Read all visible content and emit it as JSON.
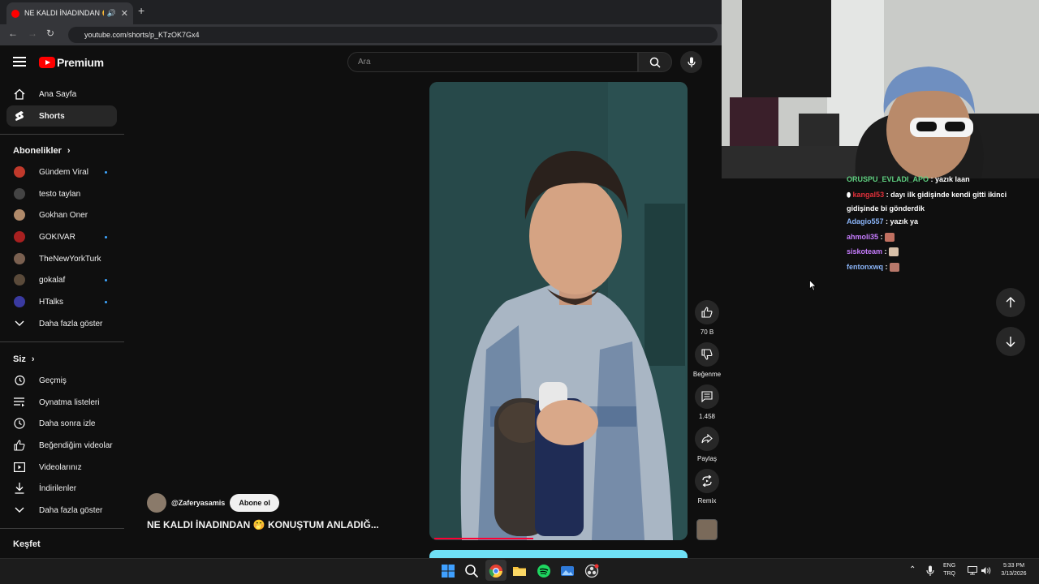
{
  "browser": {
    "tab_title": "NE KALDI İNADINDAN 🤭 K...",
    "tab_close": "✕",
    "new_tab": "+",
    "url": "youtube.com/shorts/p_KTzOK7Gx4"
  },
  "header": {
    "logo_text": "Premium",
    "search_placeholder": "Ara"
  },
  "sidebar": {
    "top_items": [
      {
        "label": "Ana Sayfa",
        "icon": "home-icon"
      },
      {
        "label": "Shorts",
        "icon": "shorts-icon"
      }
    ],
    "subscriptions_title": "Abonelikler",
    "subscriptions": [
      {
        "label": "Gündem Viral",
        "color": "#c0392b",
        "new": true
      },
      {
        "label": "testo taylan",
        "color": "#444444",
        "new": false
      },
      {
        "label": "Gokhan Oner",
        "color": "#b08a6a",
        "new": false
      },
      {
        "label": "GOKIVAR",
        "color": "#a82020",
        "new": true
      },
      {
        "label": "TheNewYorkTurk",
        "color": "#7a6050",
        "new": false
      },
      {
        "label": "gokalaf",
        "color": "#5a4a3a",
        "new": true
      },
      {
        "label": "HTalks",
        "color": "#3a3aa0",
        "new": true
      }
    ],
    "subs_more": "Daha fazla göster",
    "you_title": "Siz",
    "you_items": [
      {
        "label": "Geçmiş",
        "icon": "history-icon"
      },
      {
        "label": "Oynatma listeleri",
        "icon": "playlist-icon"
      },
      {
        "label": "Daha sonra izle",
        "icon": "clock-icon"
      },
      {
        "label": "Beğendiğim videolar",
        "icon": "thumb-up-icon"
      },
      {
        "label": "Videolarınız",
        "icon": "video-icon"
      },
      {
        "label": "İndirilenler",
        "icon": "download-icon"
      }
    ],
    "you_more": "Daha fazla göster",
    "explore_title": "Keşfet"
  },
  "video": {
    "channel": "@Zaferyasamis",
    "subscribe": "Abone ol",
    "title": "NE KALDI İNADINDAN 🤭 KONUŞTUM ANLADIĞ...",
    "progress": 0.4
  },
  "actions": {
    "likes": "70 B",
    "dislike": "Beğenme",
    "comments": "1.458",
    "share": "Paylaş",
    "remix": "Remix"
  },
  "chat": [
    {
      "user": "ORUSPU_EVLADI_APO",
      "color": "#5fcf80",
      "text": ": yazık laan",
      "badge": false
    },
    {
      "user": "kangal53",
      "color": "#e0303a",
      "text": ": dayı ilk gidişinde kendi gitti ikinci gidişinde bi gönderdik",
      "badge": true
    },
    {
      "user": "Adagio557",
      "color": "#8ab4f8",
      "text": ": yazık ya",
      "badge": false
    },
    {
      "user": "ahmoli35",
      "color": "#c77dff",
      "text": ":",
      "badge": false
    },
    {
      "user": "siskoteam",
      "color": "#c77dff",
      "text": ":",
      "badge": false
    },
    {
      "user": "fentonxwq",
      "color": "#8ab4f8",
      "text": ":",
      "badge": false
    }
  ],
  "tray": {
    "lang_top": "ENG",
    "lang_bottom": "TRQ",
    "time": "5:33 PM",
    "date": "3/13/2026"
  }
}
